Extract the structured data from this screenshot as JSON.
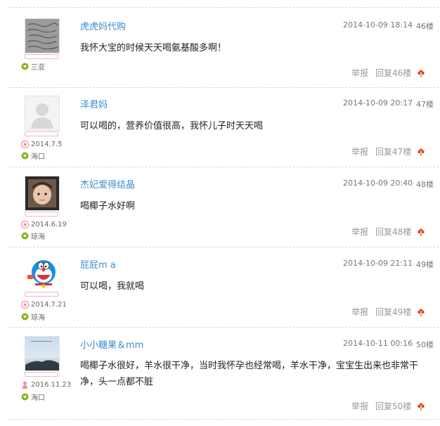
{
  "posts": [
    {
      "username": "虎虎妈代购",
      "timestamp": "2014-10-09 18:14",
      "floor": "46楼",
      "content": "我怀大宝的时候天天喝氨基酸多啊！",
      "due_date": "",
      "location": "三亚",
      "report_label": "举报",
      "reply_label": "回复46楼",
      "avatar_icon": "handwriting-photo"
    },
    {
      "username": "泽君妈",
      "timestamp": "2014-10-09 20:17",
      "floor": "47楼",
      "content": "可以喝的，营养价值很高，我怀儿子时天天喝",
      "due_date": "2014.7.5",
      "location": "海口",
      "report_label": "举报",
      "reply_label": "回复47楼",
      "avatar_icon": "default-person-avatar"
    },
    {
      "username": "杰妃爱得结晶",
      "timestamp": "2014-10-09 20:40",
      "floor": "48楼",
      "content": "喝椰子水好啊",
      "due_date": "2014.6.19",
      "location": "琼海",
      "report_label": "举报",
      "reply_label": "回复48楼",
      "avatar_icon": "baby-photo"
    },
    {
      "username": "屁屁m a",
      "timestamp": "2014-10-09 21:11",
      "floor": "49楼",
      "content": "可以喝，我就喝",
      "due_date": "2014.7.21",
      "location": "琼海",
      "report_label": "举报",
      "reply_label": "回复49楼",
      "avatar_icon": "doraemon-avatar"
    },
    {
      "username": "小小糖果＆mm",
      "timestamp": "2014-10-11 00:16",
      "floor": "50楼",
      "content": "喝椰子水很好，羊水很干净，当时我怀孕也经常喝，羊水干净，宝宝生出来也非常干净，头一点都不脏",
      "due_date": "2016.11.23",
      "location": "海口",
      "report_label": "举报",
      "reply_label": "回复50楼",
      "avatar_icon": "sky-landscape-photo"
    }
  ],
  "colors": {
    "username": "#3d8ccf",
    "meta_icon_green": "#8bb31d",
    "due_icon_pink": "#f08aa8",
    "flower_red": "#e8382f"
  }
}
